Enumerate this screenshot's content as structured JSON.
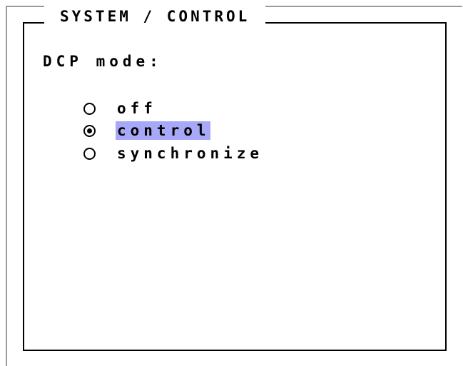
{
  "panel": {
    "title": "SYSTEM / CONTROL"
  },
  "dcp": {
    "label": "DCP mode:",
    "options": [
      {
        "label": "off",
        "checked": false
      },
      {
        "label": "control",
        "checked": true
      },
      {
        "label": "synchronize",
        "checked": false
      }
    ],
    "selected": "control",
    "highlight_color": "#a8a8f8"
  }
}
